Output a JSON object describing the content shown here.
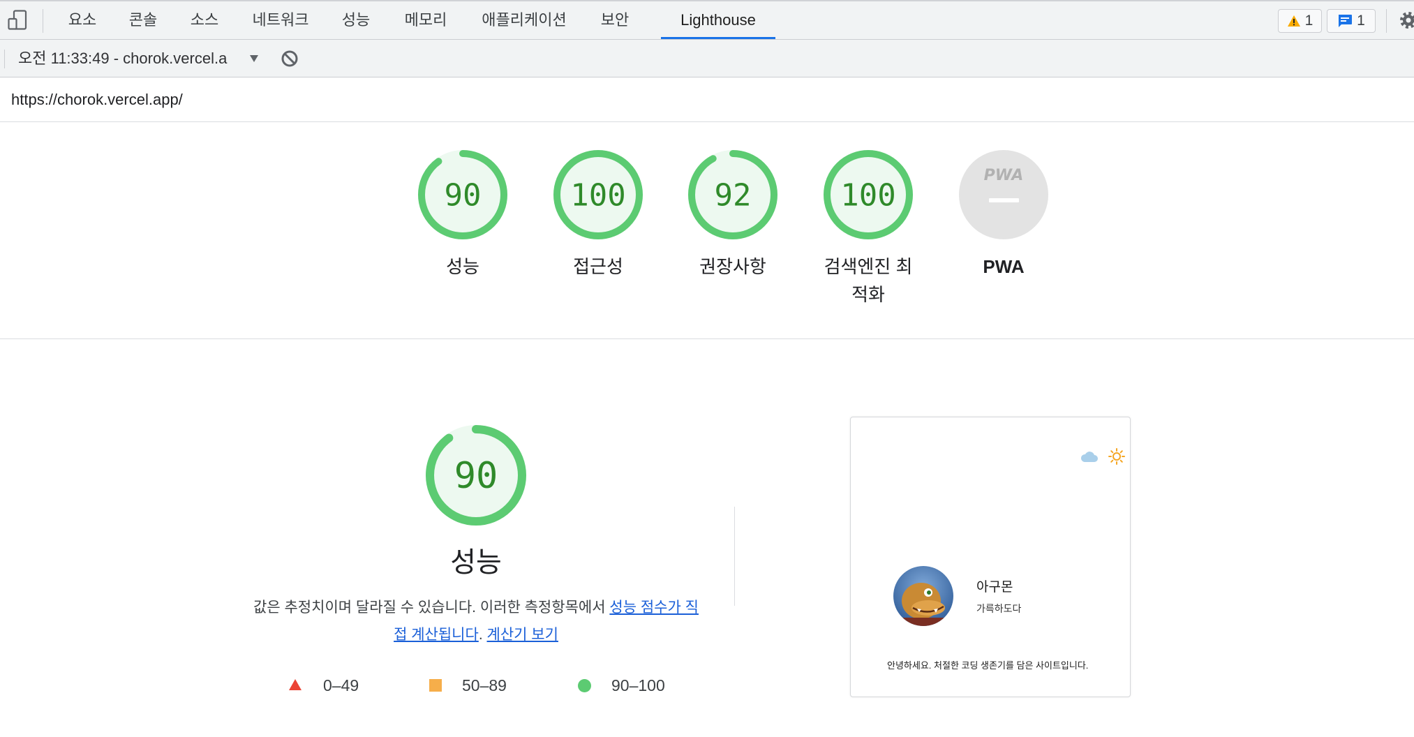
{
  "devtools": {
    "tabs": [
      {
        "label": "요소"
      },
      {
        "label": "콘솔"
      },
      {
        "label": "소스"
      },
      {
        "label": "네트워크"
      },
      {
        "label": "성능"
      },
      {
        "label": "메모리"
      },
      {
        "label": "애플리케이션"
      },
      {
        "label": "보안"
      },
      {
        "label": "Lighthouse",
        "active": true
      }
    ],
    "warning_count": "1",
    "message_count": "1"
  },
  "report_bar": {
    "selected_report": "오전 11:33:49 - chorok.vercel.a"
  },
  "url": "https://chorok.vercel.app/",
  "categories": [
    {
      "label": "성능",
      "score": 90
    },
    {
      "label": "접근성",
      "score": 100
    },
    {
      "label": "권장사항",
      "score": 92
    },
    {
      "label": "검색엔진 최적화",
      "score": 100
    },
    {
      "label": "PWA",
      "score": null,
      "badge": "PWA"
    }
  ],
  "performance": {
    "score": 90,
    "title": "성능",
    "description_text": "값은 추정치이며 달라질 수 있습니다. 이러한 측정항목에서 ",
    "score_link": "성능 점수가 직접 계산됩니다",
    "separator": ". ",
    "calculator_link": "계산기 보기",
    "legend": [
      {
        "range": "0–49",
        "shape": "triangle",
        "color": "#eb4335"
      },
      {
        "range": "50–89",
        "shape": "square",
        "color": "#f6ae4a"
      },
      {
        "range": "90–100",
        "shape": "circle",
        "color": "#5ccb72"
      }
    ]
  },
  "screenshot": {
    "name": "아구몬",
    "subtitle": "가륵하도다",
    "intro": "안녕하세요. 처절한 코딩 생존기를 담은 사이트입니다."
  },
  "colors": {
    "accent": "#1a73e8",
    "pass": "#5ccb72",
    "pass_text": "#2f8a2a",
    "link": "#1a5fd8"
  },
  "icons": {
    "device_toggle": "device-toolbar-icon",
    "warning": "warning-icon",
    "message": "message-icon",
    "settings": "gear-icon",
    "clear": "block-icon",
    "dropdown": "dropdown-arrow-icon",
    "dark_theme": "cloud-icon",
    "light_theme": "sun-icon"
  }
}
